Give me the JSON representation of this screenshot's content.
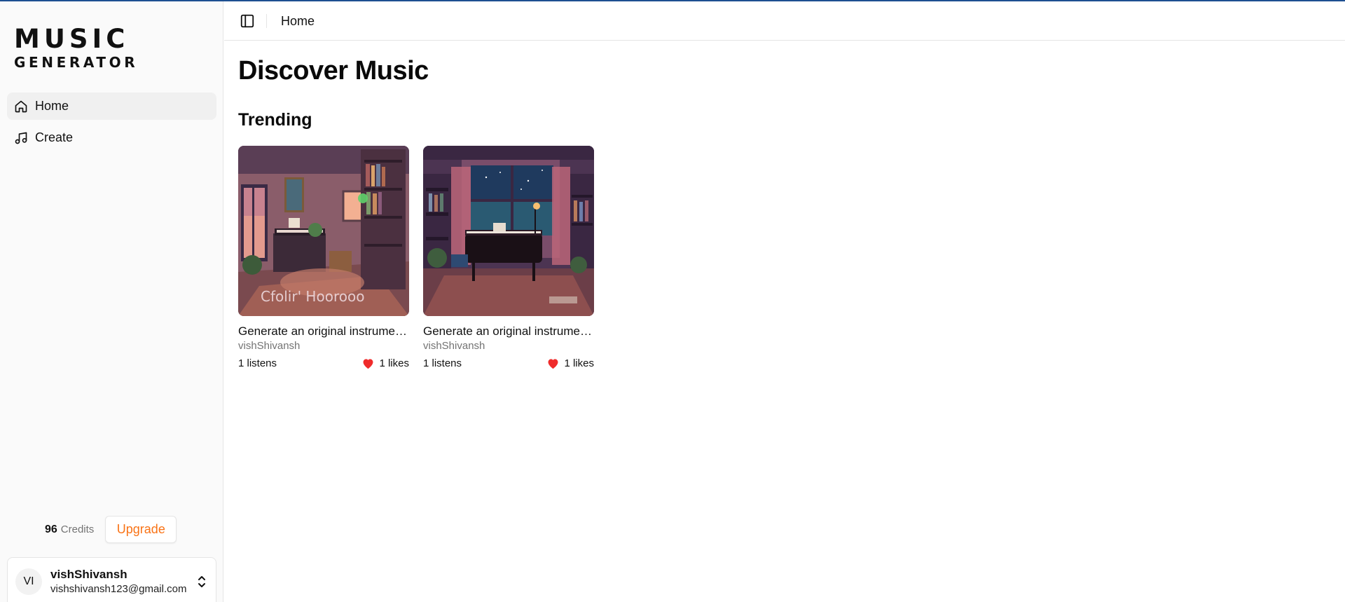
{
  "app": {
    "logo_line1": "MUSIC",
    "logo_line2": "GENERATOR"
  },
  "sidebar": {
    "items": [
      {
        "label": "Home",
        "icon": "home-icon",
        "active": true
      },
      {
        "label": "Create",
        "icon": "music-note-icon",
        "active": false
      }
    ],
    "credits": {
      "count": "96",
      "label": "Credits"
    },
    "upgrade_label": "Upgrade",
    "user": {
      "initials": "VI",
      "name": "vishShivansh",
      "email": "vishshivansh123@gmail.com"
    }
  },
  "header": {
    "breadcrumb": "Home"
  },
  "main": {
    "title": "Discover Music",
    "section_title": "Trending",
    "cards": [
      {
        "title": "Generate an original instrumental lofi track",
        "author": "vishShivansh",
        "listens": "1 listens",
        "likes": "1 likes",
        "image_caption": "Cfolir' Hoorooo"
      },
      {
        "title": "Generate an original instrumental lofi track",
        "author": "vishShivansh",
        "listens": "1 listens",
        "likes": "1 likes"
      }
    ]
  },
  "colors": {
    "accent_orange": "#f97316",
    "heart_red": "#ef2b2b",
    "progress_bar": "#1d4f91"
  }
}
